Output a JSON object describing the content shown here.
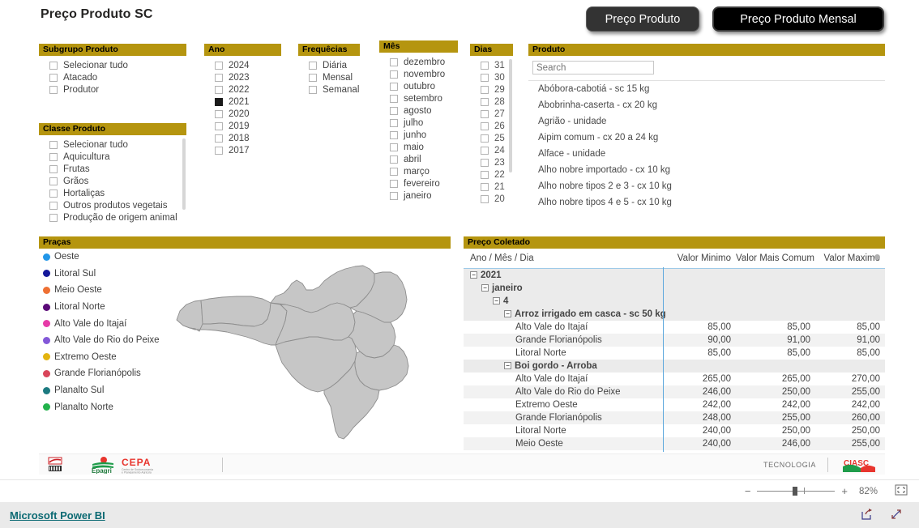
{
  "page": {
    "title": "Preço Produto SC"
  },
  "nav": {
    "preco_produto": "Preço Produto",
    "preco_produto_mensal": "Preço Produto Mensal"
  },
  "slicers": {
    "subgrupo": {
      "title": "Subgrupo Produto",
      "options": [
        {
          "label": "Selecionar tudo",
          "checked": false
        },
        {
          "label": "Atacado",
          "checked": false
        },
        {
          "label": "Produtor",
          "checked": false
        }
      ]
    },
    "classe": {
      "title": "Classe Produto",
      "options": [
        {
          "label": "Selecionar tudo",
          "checked": false
        },
        {
          "label": "Aquicultura",
          "checked": false
        },
        {
          "label": "Frutas",
          "checked": false
        },
        {
          "label": "Grãos",
          "checked": false
        },
        {
          "label": "Hortaliças",
          "checked": false
        },
        {
          "label": "Outros produtos vegetais",
          "checked": false
        },
        {
          "label": "Produção de origem animal",
          "checked": false
        }
      ]
    },
    "ano": {
      "title": "Ano",
      "options": [
        {
          "label": "2024",
          "checked": false
        },
        {
          "label": "2023",
          "checked": false
        },
        {
          "label": "2022",
          "checked": false
        },
        {
          "label": "2021",
          "checked": true
        },
        {
          "label": "2020",
          "checked": false
        },
        {
          "label": "2019",
          "checked": false
        },
        {
          "label": "2018",
          "checked": false
        },
        {
          "label": "2017",
          "checked": false
        }
      ]
    },
    "frequencias": {
      "title": "Frequêcias",
      "options": [
        {
          "label": "Diária",
          "checked": false
        },
        {
          "label": "Mensal",
          "checked": false
        },
        {
          "label": "Semanal",
          "checked": false
        }
      ]
    },
    "mes": {
      "title": "Mês",
      "options": [
        {
          "label": "dezembro",
          "checked": false
        },
        {
          "label": "novembro",
          "checked": false
        },
        {
          "label": "outubro",
          "checked": false
        },
        {
          "label": "setembro",
          "checked": false
        },
        {
          "label": "agosto",
          "checked": false
        },
        {
          "label": "julho",
          "checked": false
        },
        {
          "label": "junho",
          "checked": false
        },
        {
          "label": "maio",
          "checked": false
        },
        {
          "label": "abril",
          "checked": false
        },
        {
          "label": "março",
          "checked": false
        },
        {
          "label": "fevereiro",
          "checked": false
        },
        {
          "label": "janeiro",
          "checked": false
        }
      ]
    },
    "dias": {
      "title": "Dias",
      "options": [
        {
          "label": "31",
          "checked": false
        },
        {
          "label": "30",
          "checked": false
        },
        {
          "label": "29",
          "checked": false
        },
        {
          "label": "28",
          "checked": false
        },
        {
          "label": "27",
          "checked": false
        },
        {
          "label": "26",
          "checked": false
        },
        {
          "label": "25",
          "checked": false
        },
        {
          "label": "24",
          "checked": false
        },
        {
          "label": "23",
          "checked": false
        },
        {
          "label": "22",
          "checked": false
        },
        {
          "label": "21",
          "checked": false
        },
        {
          "label": "20",
          "checked": false
        }
      ]
    }
  },
  "produto": {
    "title": "Produto",
    "search_placeholder": "Search",
    "search_value": "",
    "items": [
      "Abóbora-cabotiá - sc 15 kg",
      "Abobrinha-caserta - cx 20 kg",
      "Agrião - unidade",
      "Aipim comum - cx 20 a 24 kg",
      "Alface - unidade",
      "Alho nobre importado - cx 10 kg",
      "Alho nobre tipos 2 e 3 - cx 10 kg",
      "Alho nobre tipos 4 e 5 - cx 10 kg"
    ]
  },
  "pracas": {
    "title": "Praças",
    "items": [
      {
        "label": "Oeste",
        "color": "#2196E8"
      },
      {
        "label": "Litoral Sul",
        "color": "#14189B"
      },
      {
        "label": "Meio Oeste",
        "color": "#EE7033"
      },
      {
        "label": "Litoral Norte",
        "color": "#5B0A78"
      },
      {
        "label": "Alto Vale do Itajaí",
        "color": "#E63BA8"
      },
      {
        "label": "Alto Vale do Rio do Peixe",
        "color": "#8358D8"
      },
      {
        "label": "Extremo Oeste",
        "color": "#E3B410"
      },
      {
        "label": "Grande Florianópolis",
        "color": "#D9455A"
      },
      {
        "label": "Planalto Sul",
        "color": "#1C7A80"
      },
      {
        "label": "Planalto Norte",
        "color": "#22B24C"
      }
    ]
  },
  "tabela": {
    "title": "Preço Coletado",
    "columns": [
      "Ano / Mês / Dia",
      "Valor Minimo",
      "Valor Mais Comum",
      "Valor Maximo"
    ],
    "rows": [
      {
        "level": 0,
        "label": "2021",
        "group": true,
        "expander": "−",
        "min": "",
        "comum": "",
        "max": ""
      },
      {
        "level": 1,
        "label": "janeiro",
        "group": true,
        "expander": "−",
        "min": "",
        "comum": "",
        "max": ""
      },
      {
        "level": 2,
        "label": "4",
        "group": true,
        "expander": "−",
        "min": "",
        "comum": "",
        "max": ""
      },
      {
        "level": 3,
        "label": "Arroz irrigado em casca - sc 50 kg",
        "group": true,
        "expander": "−",
        "min": "",
        "comum": "",
        "max": ""
      },
      {
        "level": 4,
        "label": "Alto Vale do Itajaí",
        "group": false,
        "expander": "",
        "min": "85,00",
        "comum": "85,00",
        "max": "85,00"
      },
      {
        "level": 4,
        "label": "Grande Florianópolis",
        "group": false,
        "expander": "",
        "min": "90,00",
        "comum": "91,00",
        "max": "91,00"
      },
      {
        "level": 4,
        "label": "Litoral Norte",
        "group": false,
        "expander": "",
        "min": "85,00",
        "comum": "85,00",
        "max": "85,00"
      },
      {
        "level": 3,
        "label": "Boi gordo - Arroba",
        "group": true,
        "expander": "−",
        "min": "",
        "comum": "",
        "max": ""
      },
      {
        "level": 4,
        "label": "Alto Vale do Itajaí",
        "group": false,
        "expander": "",
        "min": "265,00",
        "comum": "265,00",
        "max": "270,00"
      },
      {
        "level": 4,
        "label": "Alto Vale do Rio do Peixe",
        "group": false,
        "expander": "",
        "min": "246,00",
        "comum": "250,00",
        "max": "255,00"
      },
      {
        "level": 4,
        "label": "Extremo Oeste",
        "group": false,
        "expander": "",
        "min": "242,00",
        "comum": "242,00",
        "max": "242,00"
      },
      {
        "level": 4,
        "label": "Grande Florianópolis",
        "group": false,
        "expander": "",
        "min": "248,00",
        "comum": "255,00",
        "max": "260,00"
      },
      {
        "level": 4,
        "label": "Litoral Norte",
        "group": false,
        "expander": "",
        "min": "240,00",
        "comum": "250,00",
        "max": "250,00"
      },
      {
        "level": 4,
        "label": "Meio Oeste",
        "group": false,
        "expander": "",
        "min": "240,00",
        "comum": "246,00",
        "max": "255,00"
      }
    ]
  },
  "footer": {
    "epagri_name": "Epagri",
    "cepa_name": "CEPA",
    "cepa_subtitle": "Centro de Socioeconomia e Planejamento Agrícola",
    "tecnologia": "TECNOLOGIA",
    "ciasc_name": "CIASC"
  },
  "zoombar": {
    "minus": "−",
    "plus": "+",
    "value": "82%"
  },
  "statusbar": {
    "powerbi_link": "Microsoft Power BI"
  },
  "colors": {
    "header_gold": "#B5950F",
    "accent_blue": "#5EA9DD",
    "link_teal": "#0C6A73"
  }
}
